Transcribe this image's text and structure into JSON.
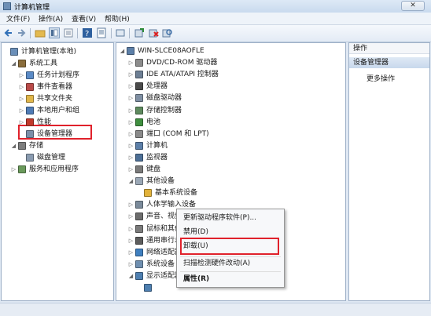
{
  "window": {
    "title": "计算机管理",
    "close_label": "✕"
  },
  "menu": [
    "文件(F)",
    "操作(A)",
    "查看(V)",
    "帮助(H)"
  ],
  "left_tree": [
    {
      "label": "计算机管理(本地)",
      "level": 0,
      "expander": "",
      "icon": "computer-icon",
      "color": "#6b8fb8"
    },
    {
      "label": "系统工具",
      "level": 1,
      "expander": "◢",
      "icon": "tools-icon",
      "color": "#8a6d3b"
    },
    {
      "label": "任务计划程序",
      "level": 2,
      "expander": "▷",
      "icon": "clock-icon",
      "color": "#5a8ac6"
    },
    {
      "label": "事件查看器",
      "level": 2,
      "expander": "▷",
      "icon": "event-icon",
      "color": "#b94a48"
    },
    {
      "label": "共享文件夹",
      "level": 2,
      "expander": "▷",
      "icon": "folder-icon",
      "color": "#e0b64a"
    },
    {
      "label": "本地用户和组",
      "level": 2,
      "expander": "▷",
      "icon": "users-icon",
      "color": "#4f7bb5"
    },
    {
      "label": "性能",
      "level": 2,
      "expander": "▷",
      "icon": "performance-icon",
      "color": "#c0392b"
    },
    {
      "label": "设备管理器",
      "level": 2,
      "expander": "",
      "icon": "device-manager-icon",
      "color": "#7a8ea8"
    },
    {
      "label": "存储",
      "level": 1,
      "expander": "◢",
      "icon": "storage-icon",
      "color": "#7d7d7d"
    },
    {
      "label": "磁盘管理",
      "level": 2,
      "expander": "",
      "icon": "disk-icon",
      "color": "#8a9bb0"
    },
    {
      "label": "服务和应用程序",
      "level": 1,
      "expander": "▷",
      "icon": "services-icon",
      "color": "#6a9a5b"
    }
  ],
  "device_tree": [
    {
      "label": "WIN-SLCE08AOFLE",
      "level": 0,
      "expander": "◢",
      "icon": "computer-icon",
      "color": "#5c7fa8"
    },
    {
      "label": "DVD/CD-ROM 驱动器",
      "level": 1,
      "expander": "▷",
      "icon": "dvd-icon",
      "color": "#8c8c8c"
    },
    {
      "label": "IDE ATA/ATAPI 控制器",
      "level": 1,
      "expander": "▷",
      "icon": "ide-icon",
      "color": "#6d7f94"
    },
    {
      "label": "处理器",
      "level": 1,
      "expander": "▷",
      "icon": "processor-icon",
      "color": "#4a4a4a"
    },
    {
      "label": "磁盘驱动器",
      "level": 1,
      "expander": "▷",
      "icon": "disk-drive-icon",
      "color": "#7f8fa3"
    },
    {
      "label": "存储控制器",
      "level": 1,
      "expander": "▷",
      "icon": "storage-controller-icon",
      "color": "#5e8a5e"
    },
    {
      "label": "电池",
      "level": 1,
      "expander": "▷",
      "icon": "battery-icon",
      "color": "#3f8f3f"
    },
    {
      "label": "端口 (COM 和 LPT)",
      "level": 1,
      "expander": "▷",
      "icon": "port-icon",
      "color": "#8a8a8a"
    },
    {
      "label": "计算机",
      "level": 1,
      "expander": "▷",
      "icon": "computer-icon",
      "color": "#5c7fa8"
    },
    {
      "label": "监视器",
      "level": 1,
      "expander": "▷",
      "icon": "monitor-icon",
      "color": "#4d6f96"
    },
    {
      "label": "键盘",
      "level": 1,
      "expander": "▷",
      "icon": "keyboard-icon",
      "color": "#7a7a7a"
    },
    {
      "label": "其他设备",
      "level": 1,
      "expander": "◢",
      "icon": "other-devices-icon",
      "color": "#9aa7b5"
    },
    {
      "label": "基本系统设备",
      "level": 2,
      "expander": "",
      "icon": "warning-device-icon",
      "color": "#e2b23a"
    },
    {
      "label": "人体学输入设备",
      "level": 1,
      "expander": "▷",
      "icon": "hid-icon",
      "color": "#7a8a9a"
    },
    {
      "label": "声音、视频和游戏控制器",
      "level": 1,
      "expander": "▷",
      "icon": "sound-icon",
      "color": "#6c6c6c"
    },
    {
      "label": "鼠标和其他指针设备",
      "level": 1,
      "expander": "▷",
      "icon": "mouse-icon",
      "color": "#7a7a7a"
    },
    {
      "label": "通用串行总线控制器",
      "level": 1,
      "expander": "▷",
      "icon": "usb-icon",
      "color": "#5d5d5d"
    },
    {
      "label": "网络适配器",
      "level": 1,
      "expander": "▷",
      "icon": "network-icon",
      "color": "#3f7fbf"
    },
    {
      "label": "系统设备",
      "level": 1,
      "expander": "▷",
      "icon": "system-devices-icon",
      "color": "#6f8fb0"
    },
    {
      "label": "显示适配器",
      "level": 1,
      "expander": "◢",
      "icon": "display-adapter-icon",
      "color": "#4e7fb0"
    },
    {
      "label": "",
      "level": 2,
      "expander": "",
      "icon": "display-device-icon",
      "color": "#4e7fb0"
    }
  ],
  "actions": {
    "header": "操作",
    "section": "设备管理器",
    "more": "更多操作"
  },
  "context_menu": {
    "update": "更新驱动程序软件(P)...",
    "disable": "禁用(D)",
    "uninstall": "卸载(U)",
    "scan": "扫描检测硬件改动(A)",
    "properties": "属性(R)"
  },
  "colors": {
    "highlight": "#e0212b",
    "accent": "#2f5f9a"
  }
}
